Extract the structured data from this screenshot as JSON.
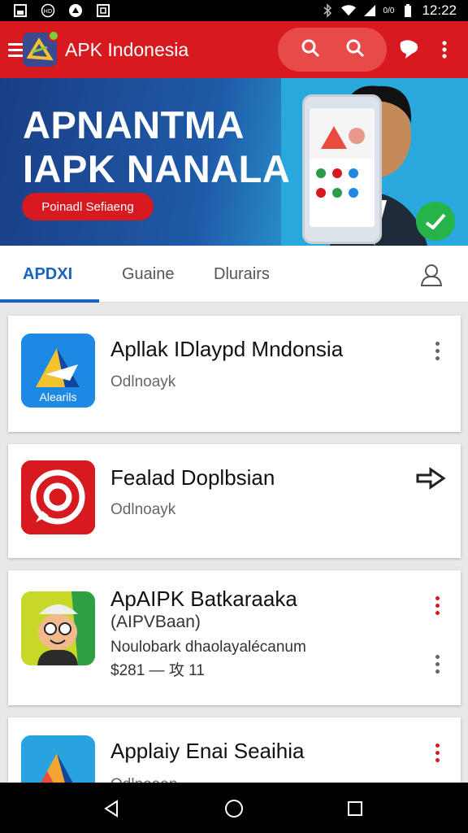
{
  "status_bar": {
    "time": "12:22",
    "battery_label": "0/0",
    "left_icons": [
      "gallery-icon",
      "hd-icon",
      "app-notification-icon",
      "screenshot-icon"
    ],
    "right_icons": [
      "bluetooth-icon",
      "wifi-icon",
      "signal-icon",
      "battery-icon"
    ]
  },
  "app_bar": {
    "title": "APK Indonesia",
    "icons": [
      "menu-icon",
      "search-icon",
      "search-icon",
      "chat-icon",
      "more-vert-icon"
    ]
  },
  "banner": {
    "title_line1": "APNANTMA",
    "title_line2": "IAPK NANALA",
    "button_label": "Poinadl Sefiaeng"
  },
  "tabs": [
    {
      "label": "APDXI",
      "active": true
    },
    {
      "label": "Guaine",
      "active": false
    },
    {
      "label": "Dlurairs",
      "active": false
    }
  ],
  "apps": [
    {
      "title": "Apllak IDlaypd Mndonsia",
      "subtitle": "Odlnoayk",
      "icon_label": "Alearils",
      "icon": "play-store-icon"
    },
    {
      "title": "Fealad Doplbsian",
      "subtitle": "Odlnoayk",
      "icon": "target-icon"
    },
    {
      "title": "ApAIPK Batkaraaka",
      "title_line2": "(AIPVBaan)",
      "line3": "Noulobark dhaolayalécanum",
      "line4": "$281 — 攻 11",
      "icon": "mascot-icon"
    },
    {
      "title": "Applaiy Enai Seaihia",
      "subtitle": "Odlnoaan",
      "icon": "drive-icon"
    }
  ],
  "colors": {
    "brand_red": "#d71920",
    "tab_blue": "#1565c0",
    "card_bg": "#ffffff"
  }
}
